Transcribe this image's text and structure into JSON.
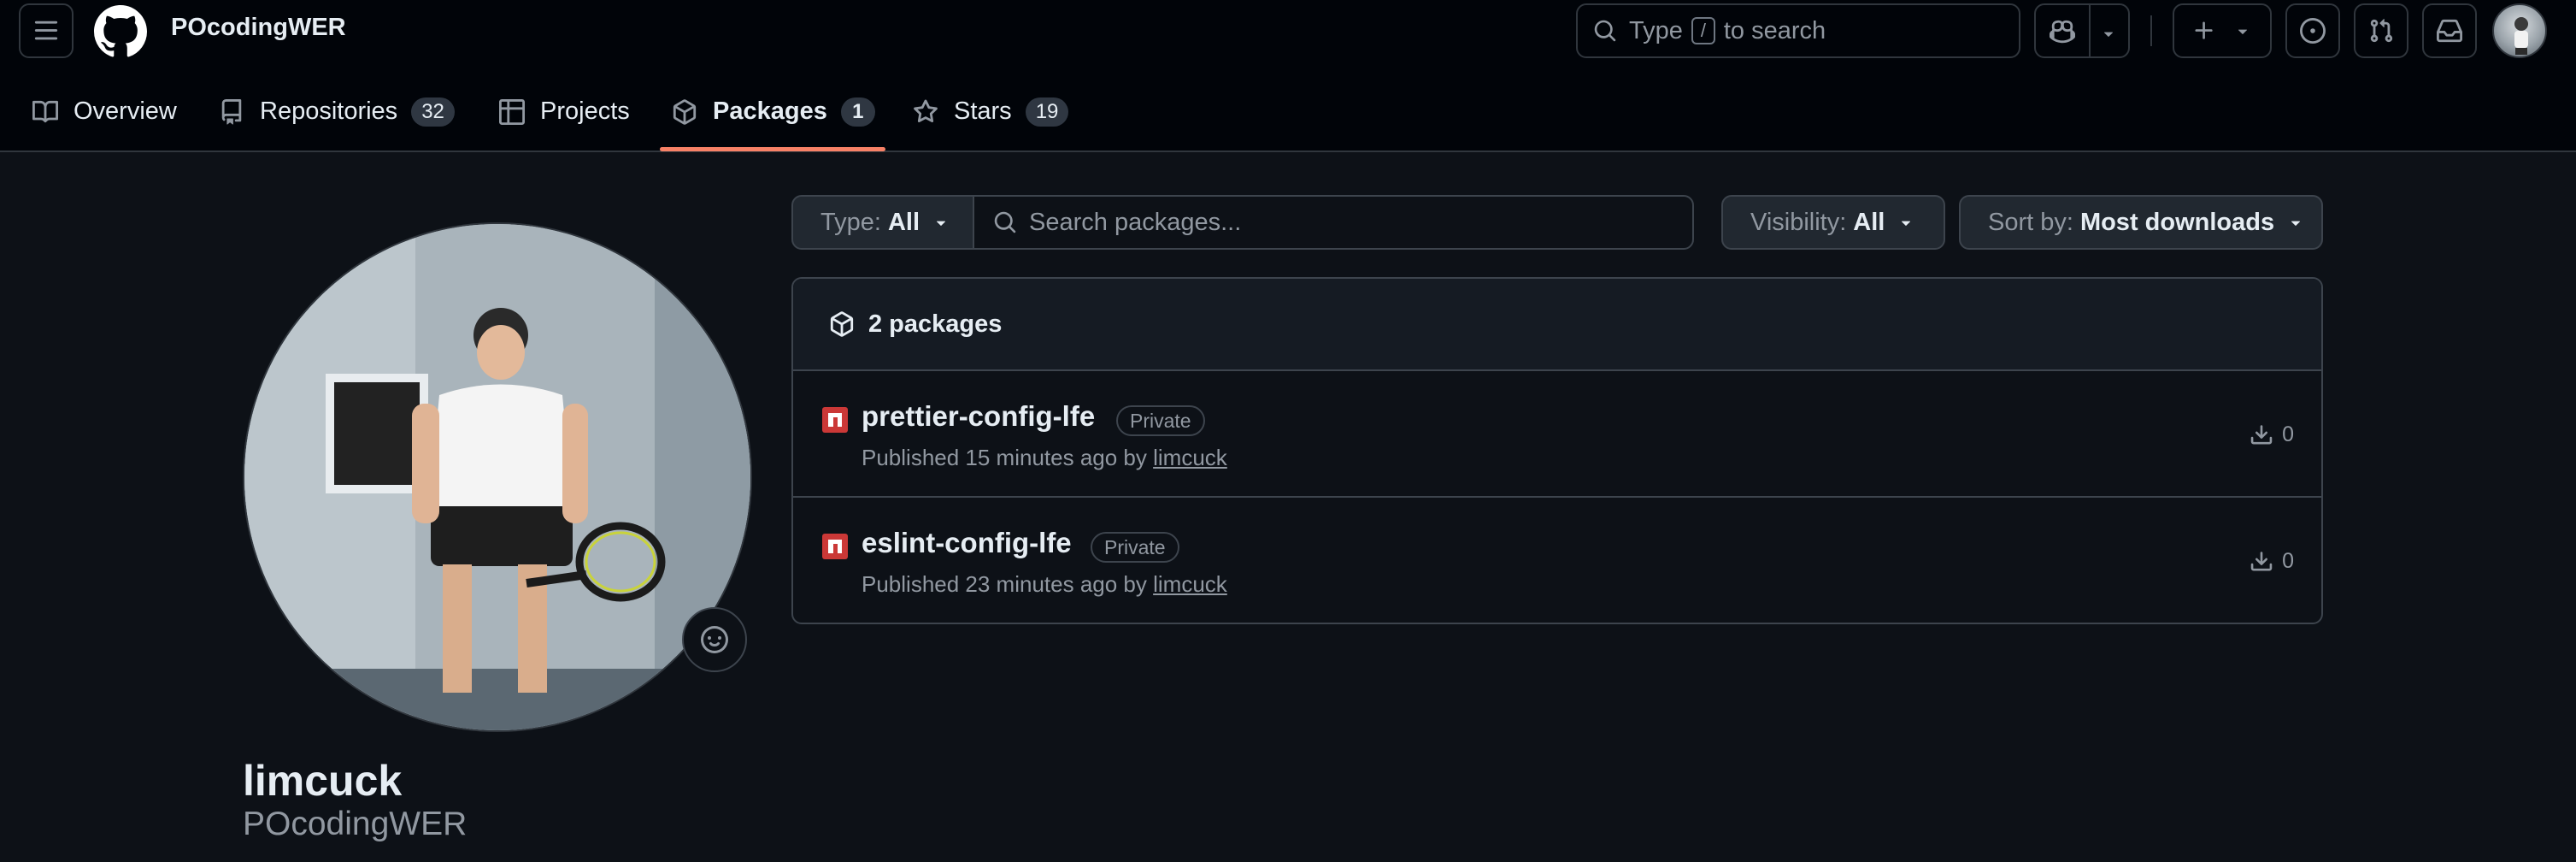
{
  "header": {
    "context_name": "POcodingWER",
    "search": {
      "prefix": "Type",
      "key": "/",
      "suffix": "to search"
    }
  },
  "tabs": [
    {
      "label": "Overview",
      "icon": "book-icon"
    },
    {
      "label": "Repositories",
      "icon": "repo-icon",
      "count": "32"
    },
    {
      "label": "Projects",
      "icon": "table-icon"
    },
    {
      "label": "Packages",
      "icon": "package-icon",
      "count": "1",
      "active": true
    },
    {
      "label": "Stars",
      "icon": "star-icon",
      "count": "19"
    }
  ],
  "profile": {
    "username": "limcuck",
    "display_name": "POcodingWER"
  },
  "filters": {
    "type": {
      "prefix": "Type:",
      "value": "All"
    },
    "search_placeholder": "Search packages...",
    "visibility": {
      "prefix": "Visibility:",
      "value": "All"
    },
    "sort": {
      "prefix": "Sort by:",
      "value": "Most downloads"
    }
  },
  "packages": {
    "summary": "2 packages",
    "items": [
      {
        "name": "prettier-config-lfe",
        "visibility": "Private",
        "published_prefix": "Published 15 minutes ago by",
        "author": "limcuck",
        "downloads": "0",
        "registry_icon": "npm-icon"
      },
      {
        "name": "eslint-config-lfe",
        "visibility": "Private",
        "published_prefix": "Published 23 minutes ago by",
        "author": "limcuck",
        "downloads": "0",
        "registry_icon": "npm-icon"
      }
    ]
  },
  "colors": {
    "background": "#0d1117",
    "header_background": "#010409",
    "tab_underline": "#f78166",
    "npm_red": "#cb3837",
    "border": "#3d444d"
  }
}
